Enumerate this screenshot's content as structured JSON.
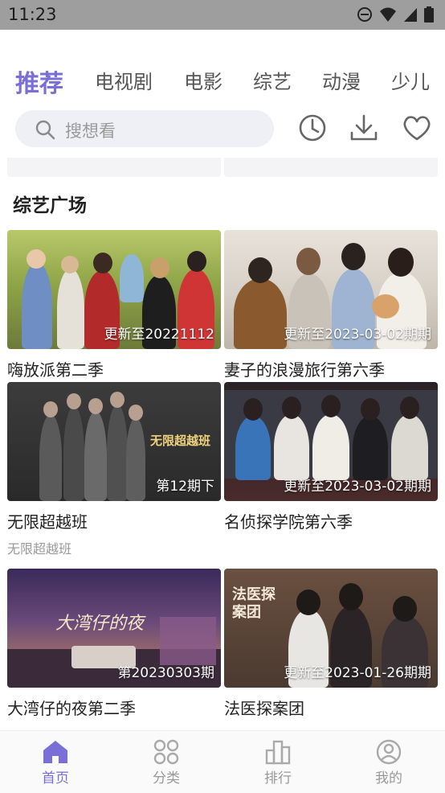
{
  "status": {
    "time": "11:23"
  },
  "tabs": [
    {
      "label": "推荐",
      "active": true
    },
    {
      "label": "电视剧"
    },
    {
      "label": "电影"
    },
    {
      "label": "综艺"
    },
    {
      "label": "动漫"
    },
    {
      "label": "少儿"
    }
  ],
  "search": {
    "placeholder": "搜想看"
  },
  "toolbar_icons": [
    "history-clock-icon",
    "download-icon",
    "favorite-heart-icon"
  ],
  "section": {
    "title": "综艺广场"
  },
  "cards": [
    {
      "title": "嗨放派第二季",
      "badge": "更新至20221112",
      "subtitle": ""
    },
    {
      "title": "妻子的浪漫旅行第六季",
      "badge": "更新至2023-03-02期期",
      "subtitle": ""
    },
    {
      "title": "无限超越班",
      "badge": "第12期下",
      "subtitle": "无限超越班",
      "poster_text": "无限超越班"
    },
    {
      "title": "名侦探学院第六季",
      "badge": "更新至2023-03-02期期",
      "subtitle": ""
    },
    {
      "title": "大湾仔的夜第二季",
      "badge": "第20230303期",
      "subtitle": "",
      "poster_text": "大湾仔的夜"
    },
    {
      "title": "法医探案团",
      "badge": "更新至2023-01-26期期",
      "subtitle": "",
      "poster_text": "法医探案团"
    }
  ],
  "nav": [
    {
      "label": "首页",
      "icon": "home-icon",
      "active": true
    },
    {
      "label": "分类",
      "icon": "category-grid-icon"
    },
    {
      "label": "排行",
      "icon": "ranking-bars-icon"
    },
    {
      "label": "我的",
      "icon": "profile-icon"
    }
  ],
  "colors": {
    "accent": "#7a6fd6",
    "status_bar": "#9e9e9e",
    "search_bg": "#eef0f5"
  }
}
